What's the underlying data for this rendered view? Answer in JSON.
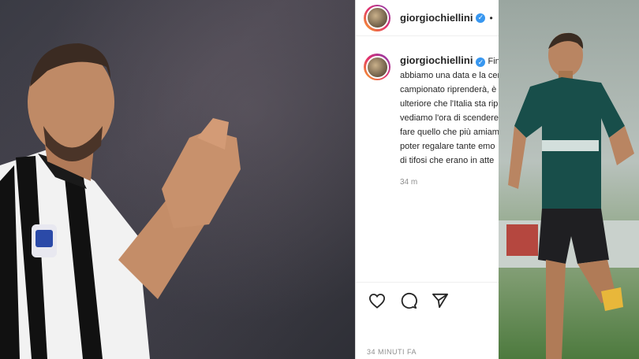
{
  "post": {
    "username": "giorgiochiellini",
    "header_dot": "•",
    "caption_lines": [
      "Finalme",
      "abbiamo una data e la cer",
      "campionato riprenderà, è",
      "ulteriore che l'Italia sta rip",
      "vediamo l'ora di scendere",
      "fare quello che più amiam",
      "poter regalare tante emo",
      "di tifosi che erano in atte"
    ],
    "comment_time": "34 m",
    "post_time": "34 MINUTI FA"
  },
  "icons": {
    "like": "heart-icon",
    "comment": "comment-icon",
    "share": "share-icon",
    "verified": "verified-badge-icon"
  },
  "colors": {
    "verified": "#3897f0",
    "muted": "#8e8e8e",
    "text": "#262626"
  }
}
